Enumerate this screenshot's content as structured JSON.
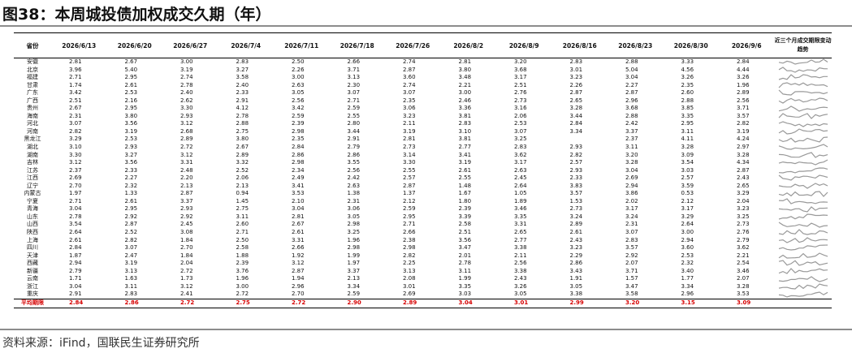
{
  "title": "图38：本周城投债加权成交久期（年）",
  "source": "资料来源：iFind，国联民生证券研究所",
  "colors": {
    "text": "#111111",
    "average_row": "#d40000",
    "sparkline": "#999999",
    "rule": "#8c8c8c"
  },
  "chart_data": {
    "type": "table",
    "title": "图38：本周城投债加权成交久期（年）",
    "header_first": "省份",
    "columns": [
      "2026/6/13",
      "2026/6/20",
      "2026/6/27",
      "2026/7/4",
      "2026/7/11",
      "2026/7/18",
      "2026/7/26",
      "2026/8/2",
      "2026/8/9",
      "2026/8/16",
      "2026/8/23",
      "2026/8/30",
      "2026/9/6"
    ],
    "spark_header": "近三个月成交期限变动趋势",
    "rows": [
      {
        "name": "安徽",
        "values": [
          "2.81",
          "2.67",
          "3.00",
          "2.83",
          "2.50",
          "2.66",
          "2.74",
          "2.81",
          "3.20",
          "2.83",
          "2.88",
          "3.33",
          "2.84"
        ]
      },
      {
        "name": "北京",
        "values": [
          "3.96",
          "5.40",
          "3.19",
          "3.27",
          "2.26",
          "3.71",
          "2.87",
          "3.80",
          "3.68",
          "3.01",
          "5.04",
          "4.56",
          "4.44"
        ]
      },
      {
        "name": "福建",
        "values": [
          "2.71",
          "2.95",
          "2.74",
          "3.58",
          "3.00",
          "3.13",
          "3.60",
          "3.48",
          "3.17",
          "3.23",
          "3.04",
          "3.26",
          "3.26"
        ]
      },
      {
        "name": "甘肃",
        "values": [
          "1.74",
          "2.61",
          "2.78",
          "2.40",
          "2.63",
          "2.30",
          "2.74",
          "2.21",
          "2.51",
          "2.26",
          "2.27",
          "2.35",
          "1.96"
        ]
      },
      {
        "name": "广东",
        "values": [
          "3.42",
          "2.53",
          "2.40",
          "2.33",
          "3.05",
          "3.07",
          "3.07",
          "3.00",
          "2.76",
          "2.87",
          "2.87",
          "2.60",
          "2.89"
        ]
      },
      {
        "name": "广西",
        "values": [
          "2.51",
          "2.16",
          "2.62",
          "2.91",
          "2.56",
          "2.71",
          "2.35",
          "2.46",
          "2.73",
          "2.65",
          "2.96",
          "2.88",
          "2.56"
        ]
      },
      {
        "name": "贵州",
        "values": [
          "2.67",
          "2.95",
          "3.30",
          "4.12",
          "3.42",
          "2.59",
          "3.06",
          "3.36",
          "3.16",
          "3.28",
          "3.68",
          "3.85",
          "3.71"
        ]
      },
      {
        "name": "海南",
        "values": [
          "2.31",
          "3.80",
          "2.93",
          "2.78",
          "2.59",
          "2.55",
          "3.23",
          "3.81",
          "2.06",
          "3.44",
          "2.88",
          "3.35",
          "3.57"
        ]
      },
      {
        "name": "河北",
        "values": [
          "3.07",
          "3.56",
          "3.12",
          "2.88",
          "2.39",
          "2.80",
          "2.11",
          "2.83",
          "2.53",
          "2.84",
          "2.42",
          "2.95",
          "2.82"
        ]
      },
      {
        "name": "河南",
        "values": [
          "2.82",
          "3.19",
          "2.68",
          "2.75",
          "2.98",
          "3.44",
          "3.19",
          "3.10",
          "3.07",
          "3.34",
          "3.37",
          "3.11",
          "3.19"
        ]
      },
      {
        "name": "黑龙江",
        "values": [
          "3.29",
          "2.53",
          "2.89",
          "3.80",
          "2.35",
          "2.91",
          "2.81",
          "3.81",
          "3.25",
          "",
          "2.37",
          "4.11",
          "4.24"
        ]
      },
      {
        "name": "湖北",
        "values": [
          "3.10",
          "2.93",
          "2.72",
          "2.67",
          "2.84",
          "2.79",
          "2.73",
          "2.77",
          "2.83",
          "2.93",
          "3.11",
          "3.28",
          "2.97"
        ]
      },
      {
        "name": "湖南",
        "values": [
          "3.30",
          "3.27",
          "3.12",
          "2.89",
          "2.86",
          "2.86",
          "3.14",
          "3.41",
          "3.62",
          "2.82",
          "3.20",
          "3.09",
          "3.28"
        ]
      },
      {
        "name": "吉林",
        "values": [
          "3.12",
          "3.56",
          "3.31",
          "3.32",
          "2.98",
          "3.55",
          "3.30",
          "3.19",
          "3.17",
          "2.57",
          "3.28",
          "3.54",
          "4.34"
        ]
      },
      {
        "name": "江苏",
        "values": [
          "2.37",
          "2.33",
          "2.48",
          "2.52",
          "2.34",
          "2.56",
          "2.55",
          "2.61",
          "2.63",
          "2.93",
          "3.04",
          "3.03",
          "2.87"
        ]
      },
      {
        "name": "江西",
        "values": [
          "2.69",
          "2.27",
          "2.20",
          "2.06",
          "2.49",
          "2.42",
          "2.57",
          "2.55",
          "2.45",
          "2.33",
          "2.69",
          "2.57",
          "2.43"
        ]
      },
      {
        "name": "辽宁",
        "values": [
          "2.70",
          "2.32",
          "2.13",
          "2.13",
          "3.41",
          "2.63",
          "2.87",
          "1.48",
          "2.64",
          "3.83",
          "2.94",
          "3.59",
          "2.65"
        ]
      },
      {
        "name": "内蒙古",
        "values": [
          "1.97",
          "1.33",
          "2.87",
          "0.94",
          "3.53",
          "1.38",
          "1.37",
          "1.67",
          "1.05",
          "3.57",
          "3.86",
          "0.53",
          "3.29"
        ]
      },
      {
        "name": "宁夏",
        "values": [
          "2.71",
          "2.61",
          "3.37",
          "1.45",
          "2.10",
          "2.31",
          "2.12",
          "1.80",
          "1.89",
          "1.53",
          "2.02",
          "2.12",
          "2.04"
        ]
      },
      {
        "name": "青海",
        "values": [
          "3.04",
          "2.95",
          "2.93",
          "2.75",
          "3.04",
          "3.06",
          "2.59",
          "2.39",
          "3.46",
          "2.73",
          "3.17",
          "3.17",
          "3.23"
        ]
      },
      {
        "name": "山东",
        "values": [
          "2.78",
          "2.92",
          "2.92",
          "3.11",
          "2.81",
          "3.05",
          "2.95",
          "3.39",
          "3.35",
          "3.24",
          "3.24",
          "3.29",
          "3.25"
        ]
      },
      {
        "name": "山西",
        "values": [
          "3.54",
          "2.87",
          "2.45",
          "2.60",
          "2.67",
          "2.98",
          "2.71",
          "2.58",
          "3.31",
          "2.89",
          "2.31",
          "2.64",
          "2.73"
        ]
      },
      {
        "name": "陕西",
        "values": [
          "2.64",
          "2.52",
          "3.08",
          "2.71",
          "2.61",
          "3.25",
          "2.66",
          "2.51",
          "2.65",
          "2.61",
          "3.07",
          "3.00",
          "2.76"
        ]
      },
      {
        "name": "上海",
        "values": [
          "2.61",
          "2.82",
          "1.84",
          "2.50",
          "3.31",
          "1.96",
          "2.38",
          "3.56",
          "2.77",
          "2.43",
          "2.83",
          "2.94",
          "2.79"
        ]
      },
      {
        "name": "四川",
        "values": [
          "2.84",
          "3.07",
          "2.70",
          "2.58",
          "2.66",
          "2.98",
          "2.98",
          "3.47",
          "3.38",
          "3.23",
          "3.57",
          "3.60",
          "3.62"
        ]
      },
      {
        "name": "天津",
        "values": [
          "1.87",
          "2.47",
          "1.84",
          "1.88",
          "1.92",
          "1.99",
          "2.82",
          "2.01",
          "2.11",
          "2.29",
          "2.92",
          "2.53",
          "2.21"
        ]
      },
      {
        "name": "西藏",
        "values": [
          "2.94",
          "3.19",
          "2.04",
          "2.39",
          "3.12",
          "1.97",
          "2.25",
          "2.78",
          "2.56",
          "2.86",
          "2.07",
          "2.32",
          "2.54"
        ]
      },
      {
        "name": "新疆",
        "values": [
          "2.79",
          "3.13",
          "2.72",
          "3.76",
          "2.87",
          "3.37",
          "3.13",
          "3.11",
          "3.38",
          "3.43",
          "3.71",
          "3.40",
          "3.46"
        ]
      },
      {
        "name": "云南",
        "values": [
          "1.71",
          "1.63",
          "1.73",
          "1.96",
          "1.94",
          "2.13",
          "2.08",
          "1.99",
          "2.43",
          "1.91",
          "1.57",
          "1.77",
          "2.07"
        ]
      },
      {
        "name": "浙江",
        "values": [
          "3.04",
          "3.11",
          "3.12",
          "3.00",
          "2.96",
          "3.34",
          "3.01",
          "3.35",
          "3.26",
          "3.05",
          "3.47",
          "3.34",
          "3.28"
        ]
      },
      {
        "name": "重庆",
        "values": [
          "2.91",
          "2.83",
          "2.41",
          "2.72",
          "2.70",
          "2.59",
          "2.69",
          "3.03",
          "3.05",
          "3.38",
          "3.58",
          "2.96",
          "3.53"
        ]
      }
    ],
    "average": {
      "name": "平均期限",
      "values": [
        "2.84",
        "2.86",
        "2.72",
        "2.75",
        "2.72",
        "2.90",
        "2.89",
        "3.04",
        "3.01",
        "2.99",
        "3.20",
        "3.15",
        "3.09"
      ]
    }
  }
}
